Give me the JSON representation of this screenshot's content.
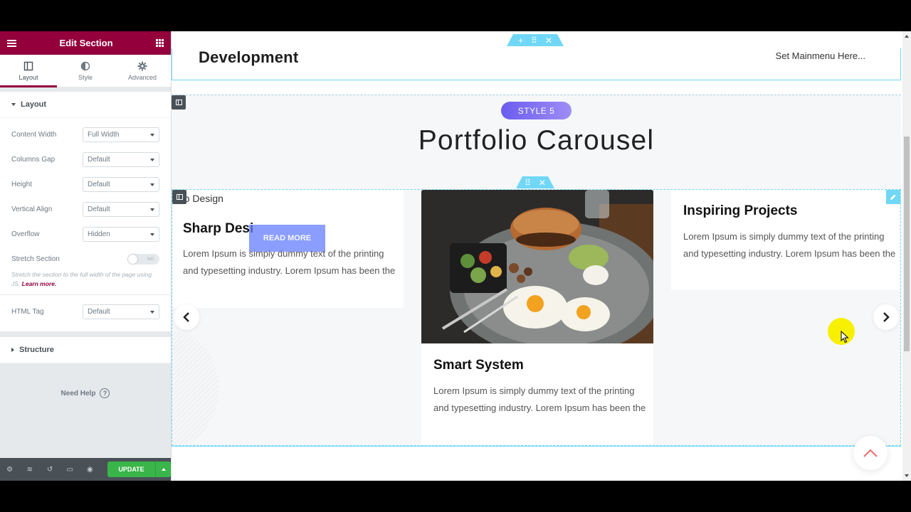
{
  "panel": {
    "title": "Edit Section",
    "tabs": [
      {
        "label": "Layout",
        "icon": "layout-icon"
      },
      {
        "label": "Style",
        "icon": "style-icon"
      },
      {
        "label": "Advanced",
        "icon": "gear-icon"
      }
    ],
    "section_layout": "Layout",
    "controls": {
      "content_width": {
        "label": "Content Width",
        "value": "Full Width"
      },
      "columns_gap": {
        "label": "Columns Gap",
        "value": "Default"
      },
      "height": {
        "label": "Height",
        "value": "Default"
      },
      "vertical_align": {
        "label": "Vertical Align",
        "value": "Default"
      },
      "overflow": {
        "label": "Overflow",
        "value": "Hidden"
      },
      "stretch": {
        "label": "Stretch Section",
        "toggle_text": "NO"
      },
      "stretch_desc": "Stretch the section to the full width of the page using JS.",
      "learn_more": "Learn more.",
      "html_tag": {
        "label": "HTML Tag",
        "value": "Default"
      }
    },
    "section_structure": "Structure",
    "need_help": "Need Help",
    "update_label": "UPDATE"
  },
  "canvas": {
    "header_title": "Development",
    "header_menu": "Set Mainmenu Here...",
    "badge": "STYLE 5",
    "title": "Portfolio Carousel",
    "cards": {
      "left_ghost": "rp Design",
      "left_title": "Sharp Desi",
      "left_text": "Lorem Ipsum is simply dummy text of the printing and typesetting industry. Lorem Ipsum has been the",
      "read_more": "READ MORE",
      "mid_title": "Smart System",
      "mid_text": "Lorem Ipsum is simply dummy text of the printing and typesetting industry. Lorem Ipsum has been the",
      "right_title": "Inspiring Projects",
      "right_text": "Lorem Ipsum is simply dummy text of the printing and typesetting industry. Lorem Ipsum has been the"
    }
  },
  "colors": {
    "panel_header": "#93003c",
    "accent_blue": "#71d7f7",
    "update_green": "#39b54a",
    "badge_gradient_start": "#6a5cf0",
    "cursor_highlight": "#f7f000"
  }
}
